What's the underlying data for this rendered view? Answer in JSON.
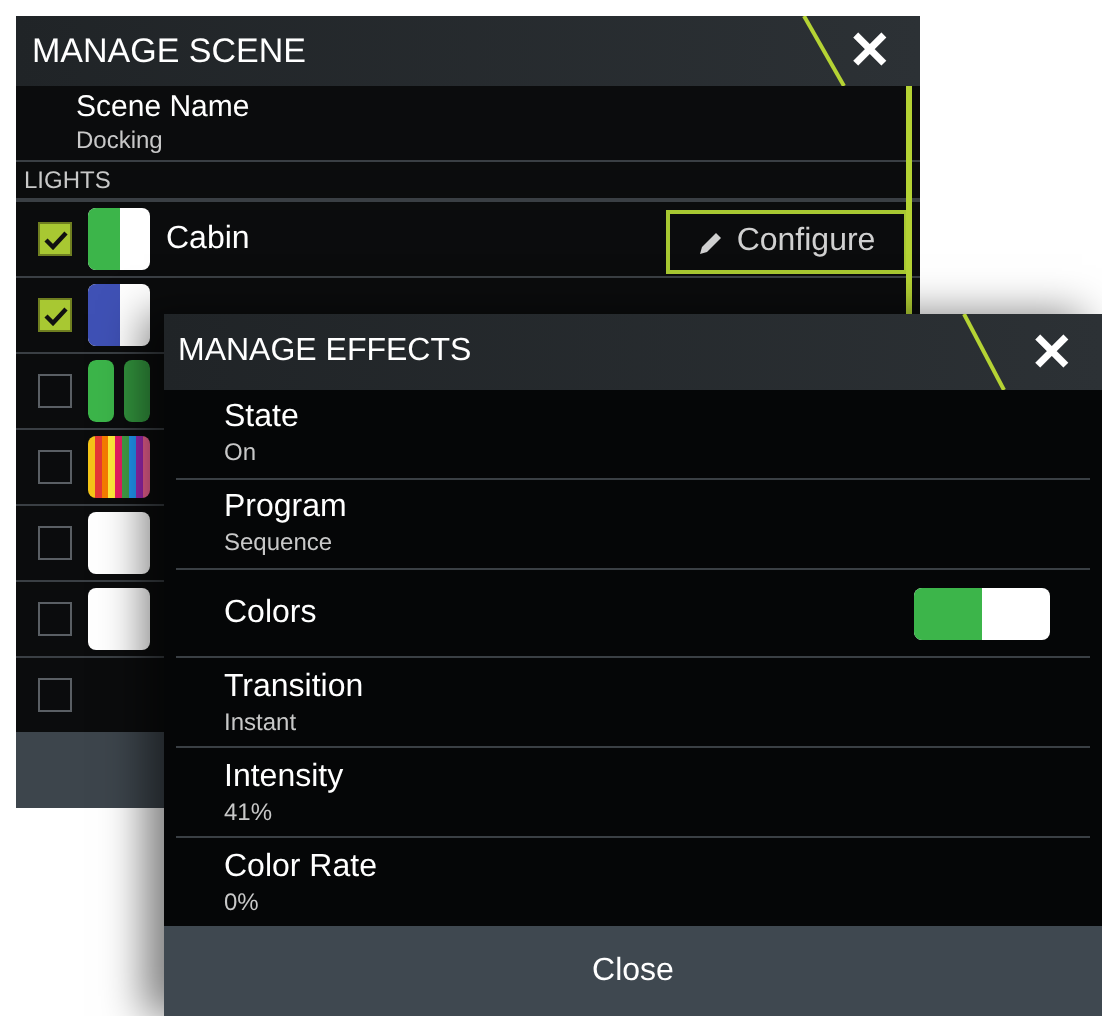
{
  "scene_window": {
    "title": "MANAGE SCENE",
    "close": "✕",
    "scene_name": {
      "label": "Scene Name",
      "value": "Docking"
    },
    "section": "LIGHTS",
    "lights": [
      {
        "name": "Cabin",
        "checked": true,
        "kind": "split",
        "color": "#3cb54a",
        "configure": "Configure"
      },
      {
        "checked": true,
        "kind": "split",
        "color": "#3f51b5"
      },
      {
        "checked": false,
        "kind": "striped",
        "color": "#3cb54a"
      },
      {
        "checked": false,
        "kind": "rainbow"
      },
      {
        "checked": false,
        "kind": "solid",
        "color": "#ffffff"
      },
      {
        "checked": false,
        "kind": "solid",
        "color": "#ffffff"
      },
      {
        "checked": false
      }
    ]
  },
  "effects_window": {
    "title": "MANAGE EFFECTS",
    "close": "✕",
    "rows": [
      {
        "kind": "value",
        "label": "State",
        "value": "On"
      },
      {
        "kind": "value",
        "label": "Program",
        "value": "Sequence"
      },
      {
        "kind": "toggle",
        "label": "Colors",
        "on": true
      },
      {
        "kind": "value",
        "label": "Transition",
        "value": "Instant"
      },
      {
        "kind": "value",
        "label": "Intensity",
        "value": "41%"
      },
      {
        "kind": "value",
        "label": "Color Rate",
        "value": "0%"
      }
    ],
    "close_button": "Close"
  }
}
